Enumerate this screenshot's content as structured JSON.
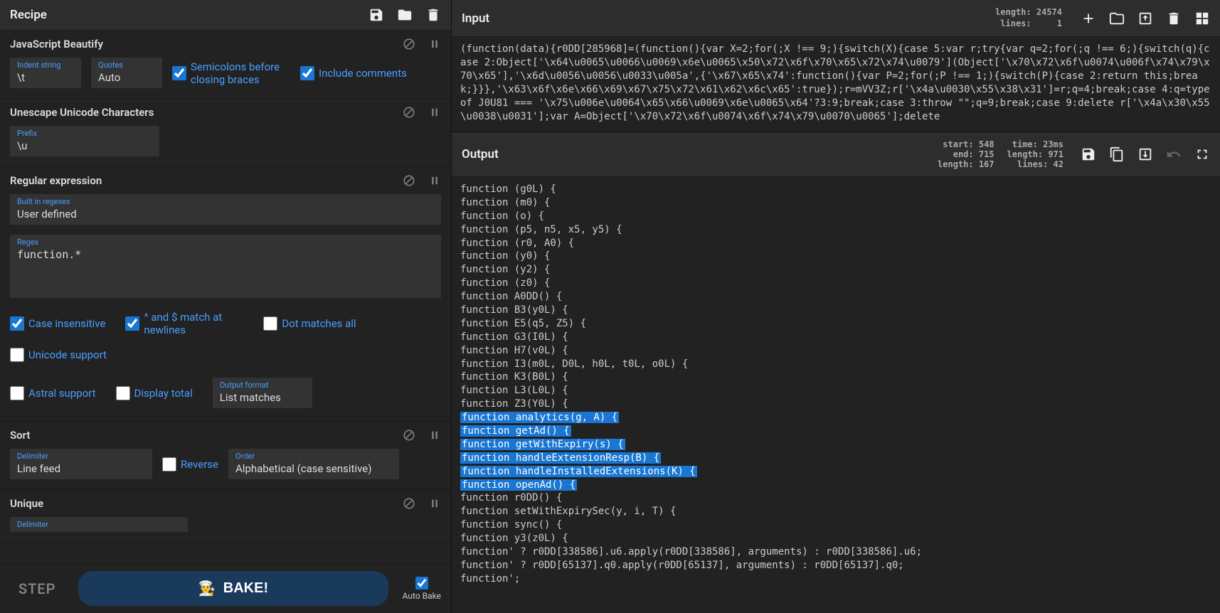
{
  "recipe": {
    "title": "Recipe",
    "ops": [
      {
        "name": "JavaScript Beautify",
        "fields": {
          "indent_label": "Indent string",
          "indent_value": "\\t",
          "quotes_label": "Quotes",
          "quotes_value": "Auto"
        },
        "checks": {
          "semicolons": {
            "label": "Semicolons before closing braces",
            "checked": true
          },
          "comments": {
            "label": "Include comments",
            "checked": true
          }
        }
      },
      {
        "name": "Unescape Unicode Characters",
        "fields": {
          "prefix_label": "Prefix",
          "prefix_value": "\\u"
        }
      },
      {
        "name": "Regular expression",
        "fields": {
          "builtin_label": "Built in regexes",
          "builtin_value": "User defined",
          "regex_label": "Regex",
          "regex_value": "function.*",
          "output_format_label": "Output format",
          "output_format_value": "List matches"
        },
        "checks": {
          "case_insensitive": {
            "label": "Case insensitive",
            "checked": true
          },
          "multiline": {
            "label": "^ and $ match at newlines",
            "checked": true
          },
          "dotall": {
            "label": "Dot matches all",
            "checked": false
          },
          "unicode": {
            "label": "Unicode support",
            "checked": false
          },
          "astral": {
            "label": "Astral support",
            "checked": false
          },
          "display_total": {
            "label": "Display total",
            "checked": false
          }
        }
      },
      {
        "name": "Sort",
        "fields": {
          "delimiter_label": "Delimiter",
          "delimiter_value": "Line feed",
          "order_label": "Order",
          "order_value": "Alphabetical (case sensitive)"
        },
        "checks": {
          "reverse": {
            "label": "Reverse",
            "checked": false
          }
        }
      },
      {
        "name": "Unique",
        "fields": {
          "delimiter_label": "Delimiter"
        }
      }
    ],
    "footer": {
      "step": "STEP",
      "bake": "BAKE!",
      "auto_bake": "Auto Bake"
    }
  },
  "input": {
    "title": "Input",
    "meta": {
      "length": "length: 24574",
      "lines": "lines:     1"
    },
    "content": "(function(data){r0DD[285968]=(function(){var X=2;for(;X !== 9;){switch(X){case 5:var r;try{var q=2;for(;q !== 6;){switch(q){case 2:Object['\\x64\\u0065\\u0066\\u0069\\x6e\\u0065\\x50\\x72\\x6f\\x70\\x65\\x72\\x74\\u0079'](Object['\\x70\\x72\\x6f\\u0074\\u006f\\x74\\x79\\x70\\x65'],'\\x6d\\u0056\\u0056\\u0033\\u005a',{'\\x67\\x65\\x74':function(){var P=2;for(;P !== 1;){switch(P){case 2:return this;break;}}},'\\x63\\x6f\\x6e\\x66\\x69\\x67\\x75\\x72\\x61\\x62\\x6c\\x65':true});r=mVV3Z;r['\\x4a\\u0030\\x55\\x38\\x31']=r;q=4;break;case 4:q=typeof J0U81 === '\\x75\\u006e\\u0064\\x65\\x66\\u0069\\x6e\\u0065\\x64'?3:9;break;case 3:throw \"\";q=9;break;case 9:delete r['\\x4a\\x30\\x55\\u0038\\u0031'];var A=Object['\\x70\\x72\\x6f\\u0074\\x6f\\x74\\x79\\u0070\\u0065'];delete"
  },
  "output": {
    "title": "Output",
    "meta": {
      "start": "start:  548",
      "end": "end:  715",
      "length": "length:  167",
      "time": "time:  23ms",
      "length2": "length:  971",
      "lines": "lines:   42"
    },
    "lines": [
      {
        "t": "function (g0L) {",
        "hl": false
      },
      {
        "t": "function (m0) {",
        "hl": false
      },
      {
        "t": "function (o) {",
        "hl": false
      },
      {
        "t": "function (p5, n5, x5, y5) {",
        "hl": false
      },
      {
        "t": "function (r0, A0) {",
        "hl": false
      },
      {
        "t": "function (y0) {",
        "hl": false
      },
      {
        "t": "function (y2) {",
        "hl": false
      },
      {
        "t": "function (z0) {",
        "hl": false
      },
      {
        "t": "function A0DD() {",
        "hl": false
      },
      {
        "t": "function B3(y0L) {",
        "hl": false
      },
      {
        "t": "function E5(q5, Z5) {",
        "hl": false
      },
      {
        "t": "function G3(I0L) {",
        "hl": false
      },
      {
        "t": "function H7(v0L) {",
        "hl": false
      },
      {
        "t": "function I3(m0L, D0L, h0L, t0L, o0L) {",
        "hl": false
      },
      {
        "t": "function K3(B0L) {",
        "hl": false
      },
      {
        "t": "function L3(L0L) {",
        "hl": false
      },
      {
        "t": "function Z3(Y0L) {",
        "hl": false
      },
      {
        "t": "function analytics(g, A) {",
        "hl": true
      },
      {
        "t": "function getAd() {",
        "hl": true
      },
      {
        "t": "function getWithExpiry(s) {",
        "hl": true
      },
      {
        "t": "function handleExtensionResp(B) {",
        "hl": true
      },
      {
        "t": "function handleInstalledExtensions(K) {",
        "hl": true
      },
      {
        "t": "function openAd() {",
        "hl": true
      },
      {
        "t": "function r0DD() {",
        "hl": false
      },
      {
        "t": "function setWithExpirySec(y, i, T) {",
        "hl": false
      },
      {
        "t": "function sync() {",
        "hl": false
      },
      {
        "t": "function y3(z0L) {",
        "hl": false
      },
      {
        "t": "function' ? r0DD[338586].u6.apply(r0DD[338586], arguments) : r0DD[338586].u6;",
        "hl": false
      },
      {
        "t": "function' ? r0DD[65137].q0.apply(r0DD[65137], arguments) : r0DD[65137].q0;",
        "hl": false
      },
      {
        "t": "function';",
        "hl": false
      }
    ]
  }
}
